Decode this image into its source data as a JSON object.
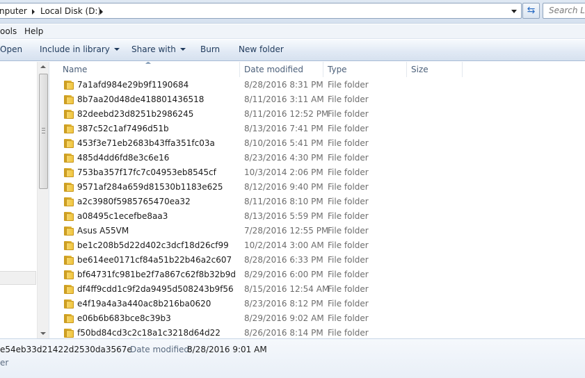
{
  "address": {
    "crumbs": [
      "nputer",
      "Local Disk (D:)"
    ],
    "refresh_icon": "refresh-arrows-icon",
    "search_placeholder": "Search Lo"
  },
  "menu": {
    "items": [
      "ools",
      "Help"
    ]
  },
  "toolbar": {
    "open_label": "Open",
    "include_label": "Include in library",
    "share_label": "Share with",
    "burn_label": "Burn",
    "new_folder_label": "New folder"
  },
  "columns": {
    "name": "Name",
    "date": "Date modified",
    "type": "Type",
    "size": "Size"
  },
  "files": [
    {
      "name": "7a1afd984e29b9f1190684",
      "date": "8/28/2016 8:31 PM",
      "type": "File folder"
    },
    {
      "name": "8b7aa20d48de418801436518",
      "date": "8/11/2016 3:11 AM",
      "type": "File folder"
    },
    {
      "name": "82deebd23d8251b2986245",
      "date": "8/11/2016 12:52 PM",
      "type": "File folder"
    },
    {
      "name": "387c52c1af7496d51b",
      "date": "8/13/2016 7:41 PM",
      "type": "File folder"
    },
    {
      "name": "453f3e71eb2683b43ffa351fc03a",
      "date": "8/10/2016 5:41 PM",
      "type": "File folder"
    },
    {
      "name": "485d4dd6fd8e3c6e16",
      "date": "8/23/2016 4:30 PM",
      "type": "File folder"
    },
    {
      "name": "753ba357f17fc7c04953eb8545cf",
      "date": "10/3/2014 2:06 PM",
      "type": "File folder"
    },
    {
      "name": "9571af284a659d81530b1183e625",
      "date": "8/12/2016 9:40 PM",
      "type": "File folder"
    },
    {
      "name": "a2c3980f5985765470ea32",
      "date": "8/11/2016 8:10 PM",
      "type": "File folder"
    },
    {
      "name": "a08495c1ecefbe8aa3",
      "date": "8/13/2016 5:59 PM",
      "type": "File folder"
    },
    {
      "name": "Asus A55VM",
      "date": "7/28/2016 12:55 PM",
      "type": "File folder"
    },
    {
      "name": "be1c208b5d22d402c3dcf18d26cf99",
      "date": "10/2/2014 3:00 AM",
      "type": "File folder"
    },
    {
      "name": "be614ee0171cf84a51b22b46a2c607",
      "date": "8/28/2016 6:33 PM",
      "type": "File folder"
    },
    {
      "name": "bf64731fc981be2f7a867c62f8b32b9d",
      "date": "8/29/2016 6:00 PM",
      "type": "File folder"
    },
    {
      "name": "df4ff9cdd1c9f2da9495d508243b9f56",
      "date": "8/15/2016 12:54 AM",
      "type": "File folder"
    },
    {
      "name": "e4f19a4a3a440ac8b216ba0620",
      "date": "8/23/2016 8:12 PM",
      "type": "File folder"
    },
    {
      "name": "e06b6b683bce8c39b3",
      "date": "8/29/2016 9:02 AM",
      "type": "File folder"
    },
    {
      "name": "f50bd84cd3c2c18a1c3218d64d22",
      "date": "8/26/2016 8:14 PM",
      "type": "File folder"
    }
  ],
  "details": {
    "name": "e54eb33d21422d2530da3567e",
    "date_label": "Date modified:",
    "date_value": "8/28/2016 9:01 AM",
    "type": "er"
  },
  "colors": {
    "folder": "#f0c540",
    "command_text": "#1e395b",
    "header_text": "#4c607a"
  }
}
